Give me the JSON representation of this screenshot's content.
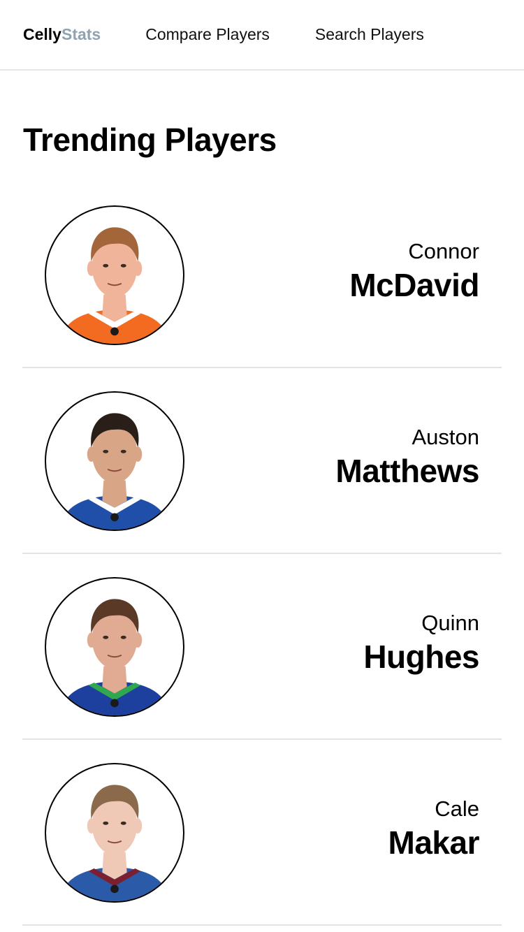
{
  "nav": {
    "brand_part1": "Celly",
    "brand_part2": "Stats",
    "links": [
      {
        "label": "Compare Players"
      },
      {
        "label": "Search Players"
      }
    ]
  },
  "page_title": "Trending Players",
  "players": [
    {
      "first": "Connor",
      "last": "McDavid",
      "jersey_color": "#f26b21",
      "jersey_trim": "#ffffff",
      "hair_color": "#a2663a",
      "skin_color": "#f0b49a"
    },
    {
      "first": "Auston",
      "last": "Matthews",
      "jersey_color": "#1f4fa8",
      "jersey_trim": "#ffffff",
      "hair_color": "#2a1e18",
      "skin_color": "#d9a587"
    },
    {
      "first": "Quinn",
      "last": "Hughes",
      "jersey_color": "#1d3f9e",
      "jersey_trim": "#2fa84f",
      "hair_color": "#5a3a26",
      "skin_color": "#e0ab92"
    },
    {
      "first": "Cale",
      "last": "Makar",
      "jersey_color": "#2a5aa8",
      "jersey_trim": "#7a2030",
      "hair_color": "#8a6a4a",
      "skin_color": "#efc8b6"
    }
  ]
}
